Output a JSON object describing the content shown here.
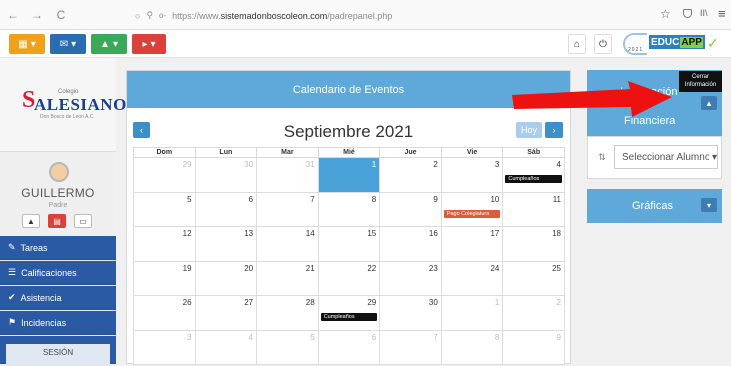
{
  "browser": {
    "url_prefix": "https://www.",
    "url_domain": "sistemadonboscoleon.com",
    "url_path": "/padrepanel.php",
    "back_glyph": "←",
    "forward_glyph": "→",
    "reload_glyph": "C",
    "star_glyph": "☆",
    "menu_glyph": "≡"
  },
  "toolbar": {
    "buttons": [
      {
        "icon": "calendar-icon",
        "color": "#f0a11b"
      },
      {
        "icon": "mail-icon",
        "color": "#2b6cb0"
      },
      {
        "icon": "user-icon",
        "color": "#3aa959"
      },
      {
        "icon": "megaphone-icon",
        "color": "#d9413a"
      }
    ],
    "caret": "▾",
    "home_glyph": "⌂",
    "power_glyph": "⏻",
    "educ_brand": "EDUC",
    "app_brand": "APP",
    "logo_year": "2021"
  },
  "sidebar": {
    "school_small": "Colegio",
    "school_initial": "S",
    "school_name": "ALESIANO",
    "school_sub": "Don Bosco de León A.C.",
    "user_name": "GUILLERMO",
    "user_role": "Padre",
    "menu": [
      {
        "label": "Tareas",
        "icon": "edit-icon",
        "glyph": "✎"
      },
      {
        "label": "Calificaciones",
        "icon": "list-icon",
        "glyph": "☰"
      },
      {
        "label": "Asistencia",
        "icon": "check-circle-icon",
        "glyph": "✔"
      },
      {
        "label": "Incidencias",
        "icon": "flag-icon",
        "glyph": "⚑"
      }
    ],
    "session_label": "SESIÓN"
  },
  "calendar": {
    "header": "Calendario de Eventos",
    "month_title": "Septiembre 2021",
    "prev_glyph": "‹",
    "next_glyph": "›",
    "today_label": "Hoy",
    "weekdays": [
      "Dom",
      "Lun",
      "Mar",
      "Mié",
      "Jue",
      "Vie",
      "Sáb"
    ],
    "weeks": [
      [
        {
          "d": "29",
          "o": true
        },
        {
          "d": "30",
          "o": true
        },
        {
          "d": "31",
          "o": true
        },
        {
          "d": "1",
          "t": true
        },
        {
          "d": "2"
        },
        {
          "d": "3"
        },
        {
          "d": "4",
          "ev": "Cumpleaños",
          "evc": "#111111"
        }
      ],
      [
        {
          "d": "5"
        },
        {
          "d": "6"
        },
        {
          "d": "7"
        },
        {
          "d": "8"
        },
        {
          "d": "9"
        },
        {
          "d": "10",
          "ev": "Pago Colegiatura",
          "evc": "#e05a3a"
        },
        {
          "d": "11"
        }
      ],
      [
        {
          "d": "12"
        },
        {
          "d": "13"
        },
        {
          "d": "14"
        },
        {
          "d": "15"
        },
        {
          "d": "16"
        },
        {
          "d": "17"
        },
        {
          "d": "18"
        }
      ],
      [
        {
          "d": "19"
        },
        {
          "d": "20"
        },
        {
          "d": "21"
        },
        {
          "d": "22"
        },
        {
          "d": "23"
        },
        {
          "d": "24"
        },
        {
          "d": "25"
        }
      ],
      [
        {
          "d": "26"
        },
        {
          "d": "27"
        },
        {
          "d": "28"
        },
        {
          "d": "29",
          "ev": "Cumpleaños",
          "evc": "#111111"
        },
        {
          "d": "30"
        },
        {
          "d": "1",
          "o": true
        },
        {
          "d": "2",
          "o": true
        }
      ],
      [
        {
          "d": "3",
          "o": true
        },
        {
          "d": "4",
          "o": true
        },
        {
          "d": "5",
          "o": true
        },
        {
          "d": "6",
          "o": true
        },
        {
          "d": "7",
          "o": true
        },
        {
          "d": "8",
          "o": true
        },
        {
          "d": "9",
          "o": true
        }
      ]
    ]
  },
  "info": {
    "title": "Información",
    "subtitle": "Financiera",
    "tooltip_line1": "Cerrar",
    "tooltip_line2": "Información",
    "select_value": "Seleccionar Alumno",
    "graphs_title": "Gráficas",
    "up_glyph": "▲",
    "down_glyph": "▾"
  }
}
